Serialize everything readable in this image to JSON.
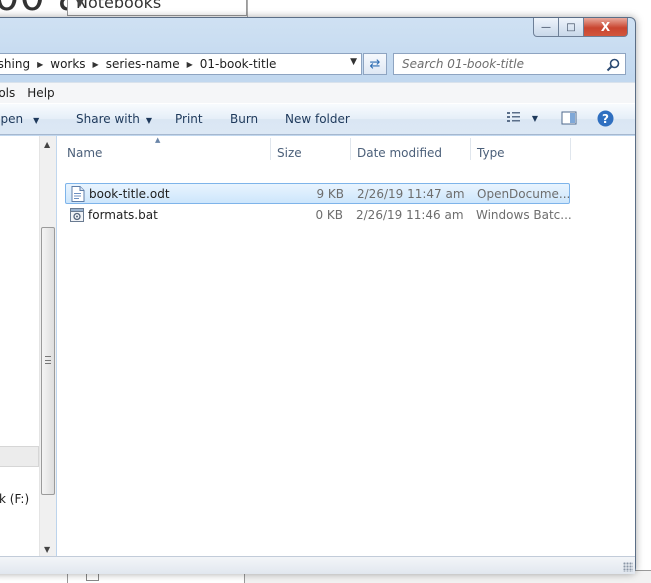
{
  "background": {
    "notebooks_label": "Notebooks"
  },
  "window": {
    "caption_buttons": {
      "minimize": "—",
      "maximize": "□",
      "close": "X"
    }
  },
  "address_bar": {
    "breadcrumbs": [
      "lishing",
      "works",
      "series-name",
      "01-book-title"
    ],
    "search_placeholder": "Search 01-book-title"
  },
  "menubar": {
    "items": [
      "ools",
      "Help"
    ]
  },
  "toolbar": {
    "open_label": "Open",
    "share_label": "Share with",
    "print_label": "Print",
    "burn_label": "Burn",
    "new_folder_label": "New folder"
  },
  "navpane": {
    "drive_label": "k (F:)"
  },
  "filelist": {
    "columns": [
      "Name",
      "Size",
      "Date modified",
      "Type"
    ],
    "rows": [
      {
        "name": "book-title.odt",
        "size": "9 KB",
        "date": "2/26/19 11:47 am",
        "type": "OpenDocume...",
        "icon": "document-icon",
        "selected": true
      },
      {
        "name": "formats.bat",
        "size": "0 KB",
        "date": "2/26/19 11:46 am",
        "type": "Windows Batc...",
        "icon": "batch-file-icon",
        "selected": false
      }
    ]
  },
  "colors": {
    "selection_fill": "#cde6fc",
    "selection_border": "#7eb4ea",
    "close_button": "#c9452f",
    "toolbar_text": "#1e395b"
  }
}
